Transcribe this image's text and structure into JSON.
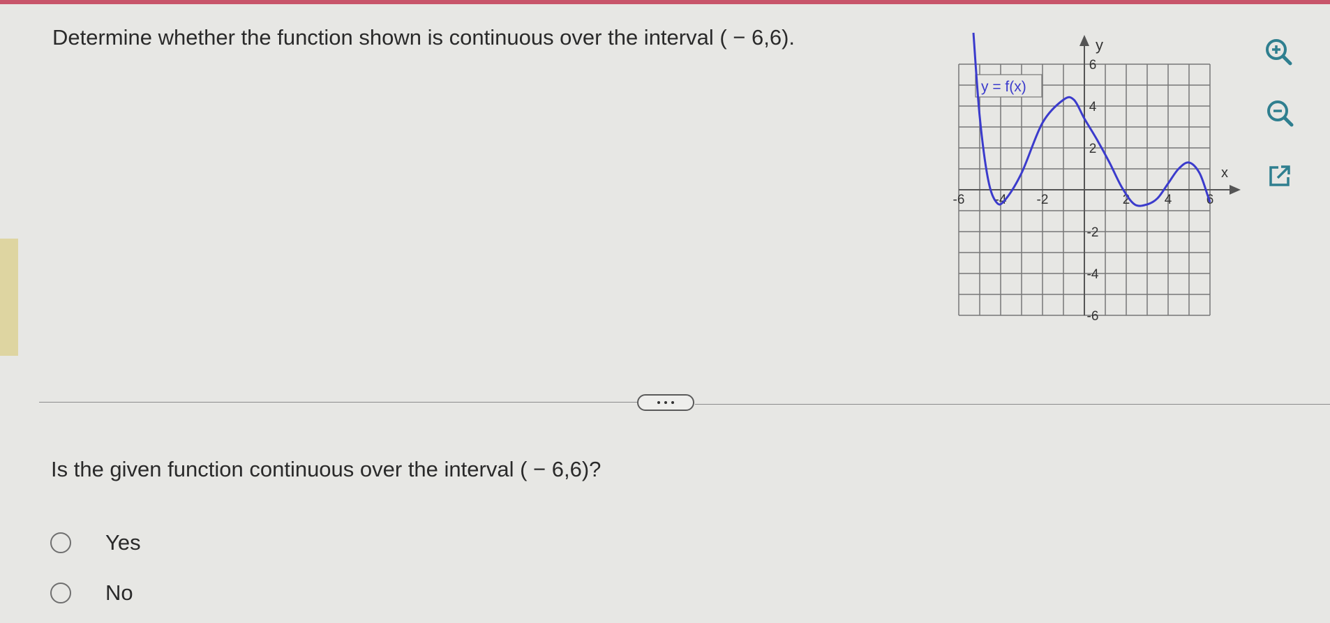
{
  "question": {
    "prompt": "Determine whether the function shown is continuous over the interval ( − 6,6).",
    "sub_prompt": "Is the given function continuous over the interval ( − 6,6)?"
  },
  "options": [
    {
      "label": "Yes",
      "selected": false
    },
    {
      "label": "No",
      "selected": false
    }
  ],
  "toolbar": {
    "zoom_in_icon": "zoom-in-icon",
    "zoom_out_icon": "zoom-out-icon",
    "popout_icon": "open-in-new-window-icon"
  },
  "expander_icon": "more-dots-icon",
  "colors": {
    "curve": "#3b3bcc",
    "grid": "#777777",
    "zoom_icon": "#2f7f8f",
    "page_background": "#e7e7e4"
  },
  "chart_data": {
    "type": "line",
    "function_label": "y = f(x)",
    "xlabel": "x",
    "ylabel": "y",
    "xlim": [
      -6,
      6
    ],
    "ylim": [
      -6,
      6
    ],
    "grid": true,
    "x_tick_labels": [
      "-6",
      "-4",
      "-2",
      "2",
      "4",
      "6"
    ],
    "y_tick_labels": [
      "6",
      "4",
      "2",
      "-2",
      "-4",
      "-6"
    ],
    "series": [
      {
        "x": [
          -5.3,
          -5.0,
          -4.6,
          -4.2,
          -3.8,
          -3.0,
          -2.0,
          -1.0,
          -0.5,
          0.0,
          0.6,
          1.2,
          1.8,
          2.4,
          3.0,
          3.5,
          4.0,
          4.5,
          5.0,
          5.5,
          5.9,
          6.0
        ],
        "y": [
          7.5,
          3.5,
          0.5,
          -0.6,
          -0.5,
          0.8,
          3.2,
          4.3,
          4.3,
          3.4,
          2.4,
          1.3,
          0.1,
          -0.7,
          -0.7,
          -0.4,
          0.3,
          1.0,
          1.3,
          0.8,
          -0.3,
          -0.6
        ]
      }
    ]
  }
}
